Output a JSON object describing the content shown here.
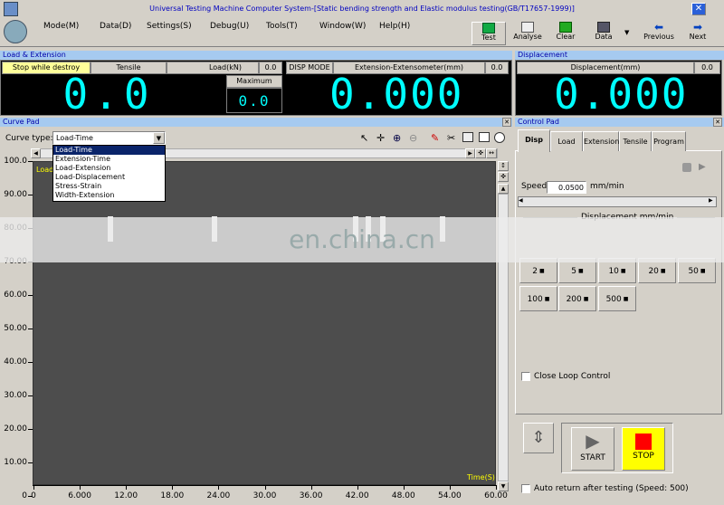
{
  "window": {
    "title": "Universal Testing Machine Computer System-[Static bending strength and Elastic modulus testing(GB/T17657-1999)]"
  },
  "menu": [
    "Mode(M)",
    "Data(D)",
    "Settings(S)",
    "Debug(U)",
    "Tools(T)",
    "Window(W)",
    "Help(H)"
  ],
  "toolbar": {
    "test": "Test",
    "analyse": "Analyse",
    "clear": "Clear",
    "data": "Data",
    "previous": "Previous",
    "next": "Next"
  },
  "load_ext": {
    "section_title": "Load & Extension",
    "mode_label": "Stop while destroy",
    "tensile_label": "Tensile",
    "load_label": "Load(kN)",
    "load_small": "0.0",
    "load_value": "0.0",
    "maximum_label": "Maximum",
    "maximum_value": "0.0",
    "disp_mode_label": "DISP MODE",
    "ext_label": "Extension-Extensometer(mm)",
    "ext_small": "0.0",
    "ext_value": "0.000"
  },
  "displacement": {
    "section_title": "Displacement",
    "label": "Displacement(mm)",
    "small": "0.0",
    "value": "0.000"
  },
  "curve_pad": {
    "section_title": "Curve Pad",
    "curve_type_label": "Curve type:",
    "curve_type_selected": "Load-Time",
    "options": [
      "Load-Time",
      "Extension-Time",
      "Load-Extension",
      "Load-Displacement",
      "Stress-Strain",
      "Width-Extension"
    ]
  },
  "chart_data": {
    "type": "line",
    "title": "",
    "xlabel": "Time(S)",
    "ylabel": "Load",
    "xlim": [
      0,
      60
    ],
    "ylim": [
      0,
      100
    ],
    "x_ticks": [
      "0",
      "6.000",
      "12.00",
      "18.00",
      "24.00",
      "30.00",
      "36.00",
      "42.00",
      "48.00",
      "54.00",
      "60.00"
    ],
    "y_ticks": [
      "100.0",
      "90.00",
      "80.00",
      "70.00",
      "60.00",
      "50.00",
      "40.00",
      "30.00",
      "20.00",
      "10.00",
      "0"
    ],
    "series": [],
    "grid": false
  },
  "control_pad": {
    "section_title": "Control Pad",
    "tabs": [
      "Disp",
      "Load",
      "Extension",
      "Tensile",
      "Program"
    ],
    "speed_label": "Speed",
    "speed_value": "0.0500",
    "speed_unit": "mm/min",
    "displacement_label": "Displacement mm/min",
    "speed_buttons_row1": [
      "2",
      "5",
      "10",
      "20",
      "50"
    ],
    "speed_buttons_row2": [
      "100",
      "200",
      "500"
    ],
    "close_loop": "Close Loop Control",
    "start": "START",
    "stop": "STOP",
    "auto_return": "Auto return after testing (Speed: 500)"
  },
  "watermark": "en.china.cn",
  "colors": {
    "display_bg": "#000000",
    "digit": "#00ffff",
    "title_bar": "#a6caf0",
    "stop_bg": "#ffff00",
    "stop_icon": "#ff0000",
    "plot_bg": "#4d4d4d"
  }
}
